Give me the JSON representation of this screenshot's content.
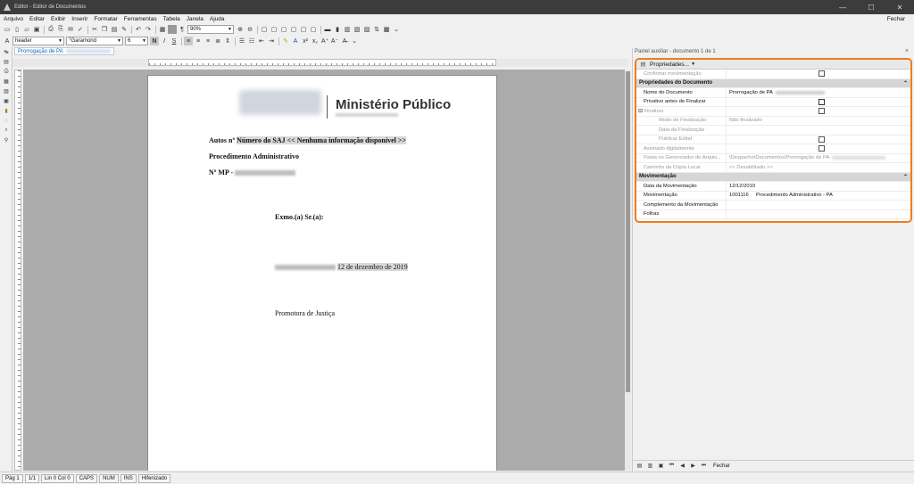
{
  "window": {
    "title": "Editor - Editor de Documentos",
    "minimize": "—",
    "maximize": "☐",
    "close": "✕"
  },
  "menu": {
    "items": [
      "Arquivo",
      "Editar",
      "Exibir",
      "Inserir",
      "Formatar",
      "Ferramentas",
      "Tabela",
      "Janela",
      "Ajuda"
    ],
    "close_label": "Fechar"
  },
  "toolbar2": {
    "style": "header",
    "font": "Garamond",
    "size": "6",
    "bold": "N",
    "italic": "I",
    "strike": "S"
  },
  "toolbar1": {
    "zoom": "90%"
  },
  "doc_tab": {
    "label": "Prorrogação de PA"
  },
  "document": {
    "logo_title": "Ministério Público",
    "autos_label": "Autos nº",
    "autos_value": "Número do SAJ << Nenhuma informação disponível >>",
    "procedure": "Procedimento Administrativo",
    "mp_label": "Nº MP -",
    "greeting": "Exmo.(a) Sr.(a):",
    "date": "12 de dezembro de 2019",
    "signature": "Promotora de Justiça"
  },
  "statusbar": [
    "Pág 1",
    "1/1",
    "Lin 0  Col 0",
    "CAPS",
    "NUM",
    "INS",
    "Hifenizado"
  ],
  "panel": {
    "title": "Painel auxiliar - documento 1 de 1",
    "close": "×",
    "tab_label": "Propriedades...",
    "rows": {
      "confirmar": "Confirmar movimentação",
      "sec_doc": "Propriedades do Documento",
      "nome_label": "Nome do Documento",
      "nome_value": "Prorrogação de PA",
      "privativo": "Privativo antes de Finalizar",
      "finalizar": "Finalizar",
      "modo_label": "Modo de Finalização",
      "modo_value": "Não finalizado",
      "data_fin": "Data da Finalização",
      "publicar": "Publicar Edital",
      "assinado": "Assinado digitalmente",
      "pasta_label": "Pasta no Gerenciador de Arquiv...",
      "pasta_value": "\\Despacho\\Documentos\\Prorrogação de PA",
      "caminho_label": "Caminho da Cópia Local",
      "caminho_value": "<< Desabilitado >>",
      "sec_mov": "Movimentação",
      "data_mov_label": "Data da Movimentação",
      "data_mov_value": "12/12/2019",
      "mov_label": "Movimentação",
      "mov_code": "1001116",
      "mov_desc": "Procedimento Administrativo - PA",
      "compl_label": "Complemento da Movimentação",
      "folhas_label": "Folhas"
    },
    "bottom_close": "Fechar"
  }
}
